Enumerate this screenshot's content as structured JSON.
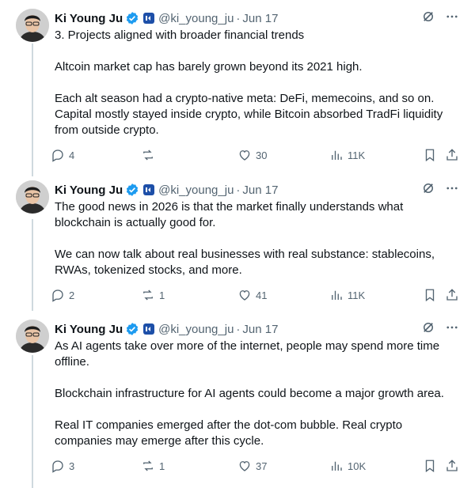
{
  "colors": {
    "text": "#0f1419",
    "secondary": "#536471",
    "verified": "#1d9bf0",
    "thread_line": "#cfd9de",
    "affiliate_badge": "#1d4fa8"
  },
  "tweets": [
    {
      "name": "Ki Young Ju",
      "handle": "@ki_young_ju",
      "separator": "·",
      "date": "Jun 17",
      "paragraphs": [
        "3. Projects aligned with broader financial trends",
        "Altcoin market cap has barely grown beyond its 2021 high.",
        "Each alt season had a crypto-native meta: DeFi, memecoins, and so on. Capital mostly stayed inside crypto, while Bitcoin absorbed TradFi liquidity from outside crypto."
      ],
      "replies": "4",
      "reposts": "",
      "likes": "30",
      "views": "11K"
    },
    {
      "name": "Ki Young Ju",
      "handle": "@ki_young_ju",
      "separator": "·",
      "date": "Jun 17",
      "paragraphs": [
        "The good news in 2026 is that the market finally understands what blockchain is actually good for.",
        "We can now talk about real businesses with real substance: stablecoins, RWAs, tokenized stocks, and more."
      ],
      "replies": "2",
      "reposts": "1",
      "likes": "41",
      "views": "11K"
    },
    {
      "name": "Ki Young Ju",
      "handle": "@ki_young_ju",
      "separator": "·",
      "date": "Jun 17",
      "paragraphs": [
        "As AI agents take over more of the internet, people may spend more time offline.",
        "Blockchain infrastructure for AI agents could become a major growth area.",
        "Real IT companies emerged after the dot-com bubble. Real crypto companies may emerge after this cycle."
      ],
      "replies": "3",
      "reposts": "1",
      "likes": "37",
      "views": "10K"
    }
  ]
}
